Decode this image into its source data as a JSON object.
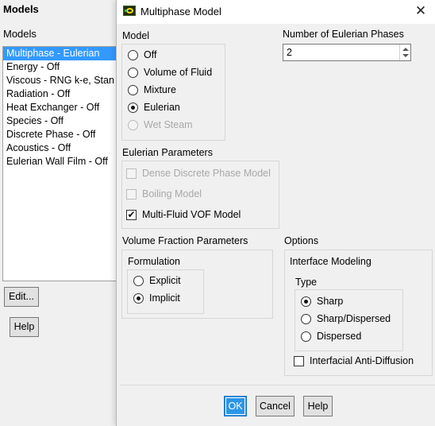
{
  "models_panel": {
    "title": "Models",
    "list_label": "Models",
    "items": [
      "Multiphase - Eulerian",
      "Energy - Off",
      "Viscous - RNG k-e, Stan",
      "Radiation - Off",
      "Heat Exchanger - Off",
      "Species - Off",
      "Discrete Phase - Off",
      "Acoustics - Off",
      "Eulerian Wall Film - Off"
    ],
    "selected_index": 0,
    "edit_label": "Edit...",
    "help_label": "Help"
  },
  "dialog": {
    "title": "Multiphase Model",
    "close_glyph": "✕",
    "model": {
      "label": "Model",
      "options": [
        "Off",
        "Volume of Fluid",
        "Mixture",
        "Eulerian",
        "Wet Steam"
      ],
      "selected": "Eulerian",
      "disabled": [
        "Wet Steam"
      ]
    },
    "eulerian_phases": {
      "label": "Number of Eulerian Phases",
      "value": "2"
    },
    "eulerian_params": {
      "label": "Eulerian Parameters",
      "options": [
        {
          "label": "Dense Discrete Phase Model",
          "checked": false,
          "enabled": false
        },
        {
          "label": "Boiling Model",
          "checked": false,
          "enabled": false
        },
        {
          "label": "Multi-Fluid VOF Model",
          "checked": true,
          "enabled": true
        }
      ],
      "check_glyph": "✔"
    },
    "volume_fraction": {
      "label": "Volume Fraction Parameters",
      "formulation_label": "Formulation",
      "options": [
        "Explicit",
        "Implicit"
      ],
      "selected": "Implicit"
    },
    "options_section": {
      "label": "Options",
      "interface_modeling_label": "Interface Modeling",
      "type_label": "Type",
      "types": [
        "Sharp",
        "Sharp/Dispersed",
        "Dispersed"
      ],
      "selected_type": "Sharp",
      "anti_diffusion": {
        "label": "Interfacial Anti-Diffusion",
        "checked": false
      }
    },
    "buttons": {
      "ok": "OK",
      "cancel": "Cancel",
      "help": "Help"
    },
    "colors": {
      "ok_button": "#2b96e8",
      "selection": "#3399ff",
      "disabled_text": "#a8a8a8"
    }
  }
}
